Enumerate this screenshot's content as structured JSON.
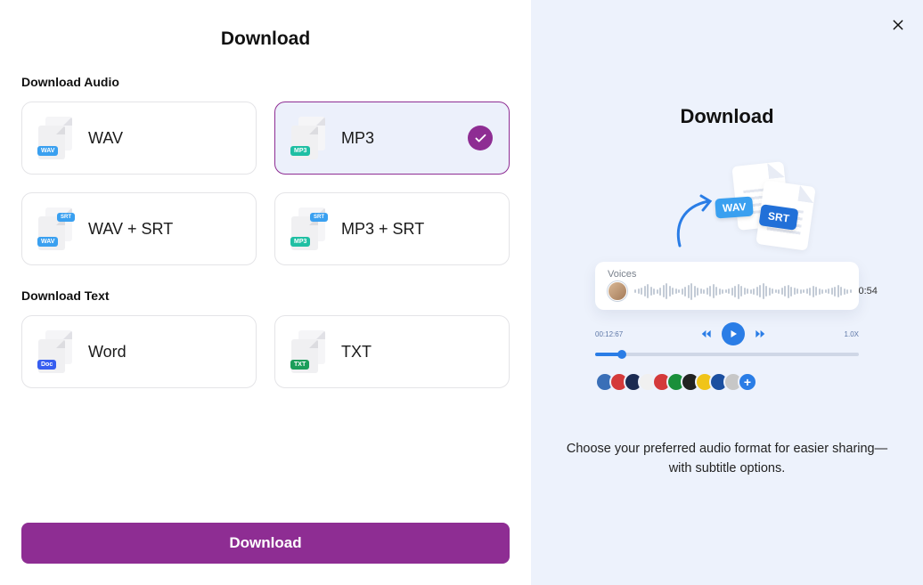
{
  "left": {
    "title": "Download",
    "audioSection": "Download Audio",
    "textSection": "Download Text",
    "options": {
      "wav": "WAV",
      "mp3": "MP3",
      "wavSrt": "WAV + SRT",
      "mp3Srt": "MP3 + SRT",
      "word": "Word",
      "txt": "TXT"
    },
    "selected": "mp3",
    "downloadBtn": "Download"
  },
  "right": {
    "title": "Download",
    "tag_wav": "WAV",
    "tag_srt": "SRT",
    "voicesLabel": "Voices",
    "duration": "0:54",
    "ptime": "00:12:67",
    "speed": "1.0X",
    "description": "Choose your preferred audio format for easier sharing—with subtitle options."
  },
  "flagColors": [
    "#3a6fb7",
    "#d43a3a",
    "#1b2b52",
    "#f0f0f0",
    "#d43a3a",
    "#1a8f3a",
    "#222",
    "#f0c419",
    "#1b4fa0",
    "#c7c7c7"
  ]
}
